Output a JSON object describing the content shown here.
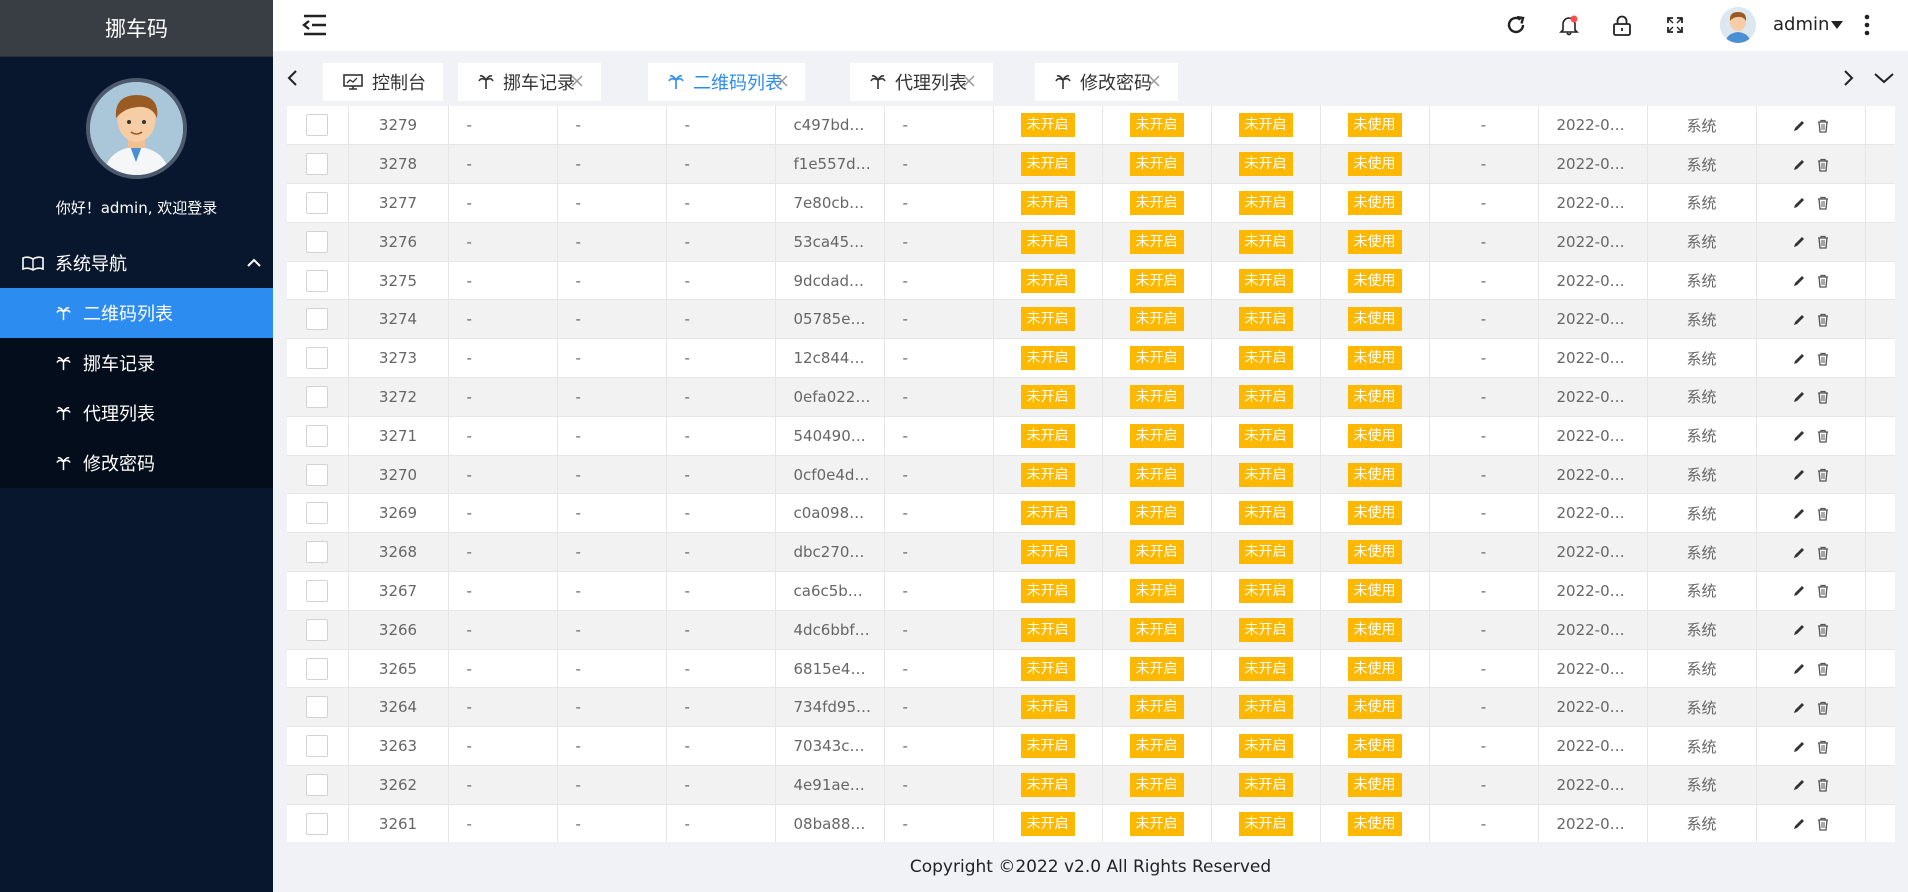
{
  "app": {
    "brand": "挪车码",
    "welcome": "你好！admin, 欢迎登录"
  },
  "sidebar": {
    "group_label": "系统导航",
    "items": [
      {
        "label": "二维码列表",
        "active": true
      },
      {
        "label": "挪车记录",
        "active": false
      },
      {
        "label": "代理列表",
        "active": false
      },
      {
        "label": "修改密码",
        "active": false
      }
    ]
  },
  "header": {
    "username": "admin"
  },
  "tabs": [
    {
      "label": "控制台",
      "icon": "monitor-icon",
      "closable": false,
      "active": false
    },
    {
      "label": "挪车记录",
      "icon": "palm-icon",
      "closable": true,
      "active": false
    },
    {
      "label": "二维码列表",
      "icon": "palm-icon",
      "closable": true,
      "active": true
    },
    {
      "label": "代理列表",
      "icon": "palm-icon",
      "closable": true,
      "active": false
    },
    {
      "label": "修改密码",
      "icon": "palm-icon",
      "closable": true,
      "active": false
    }
  ],
  "table": {
    "rows": [
      {
        "id": "3279",
        "c1": "-",
        "c2": "-",
        "c3": "-",
        "code": "c497bd…",
        "c5": "-",
        "s1": "未开启",
        "s2": "未开启",
        "s3": "未开启",
        "s4": "未使用",
        "c10": "-",
        "date": "2022-0…",
        "source": "系统"
      },
      {
        "id": "3278",
        "c1": "-",
        "c2": "-",
        "c3": "-",
        "code": "f1e557d…",
        "c5": "-",
        "s1": "未开启",
        "s2": "未开启",
        "s3": "未开启",
        "s4": "未使用",
        "c10": "-",
        "date": "2022-0…",
        "source": "系统"
      },
      {
        "id": "3277",
        "c1": "-",
        "c2": "-",
        "c3": "-",
        "code": "7e80cb…",
        "c5": "-",
        "s1": "未开启",
        "s2": "未开启",
        "s3": "未开启",
        "s4": "未使用",
        "c10": "-",
        "date": "2022-0…",
        "source": "系统"
      },
      {
        "id": "3276",
        "c1": "-",
        "c2": "-",
        "c3": "-",
        "code": "53ca45…",
        "c5": "-",
        "s1": "未开启",
        "s2": "未开启",
        "s3": "未开启",
        "s4": "未使用",
        "c10": "-",
        "date": "2022-0…",
        "source": "系统"
      },
      {
        "id": "3275",
        "c1": "-",
        "c2": "-",
        "c3": "-",
        "code": "9dcdad…",
        "c5": "-",
        "s1": "未开启",
        "s2": "未开启",
        "s3": "未开启",
        "s4": "未使用",
        "c10": "-",
        "date": "2022-0…",
        "source": "系统"
      },
      {
        "id": "3274",
        "c1": "-",
        "c2": "-",
        "c3": "-",
        "code": "05785e…",
        "c5": "-",
        "s1": "未开启",
        "s2": "未开启",
        "s3": "未开启",
        "s4": "未使用",
        "c10": "-",
        "date": "2022-0…",
        "source": "系统"
      },
      {
        "id": "3273",
        "c1": "-",
        "c2": "-",
        "c3": "-",
        "code": "12c844…",
        "c5": "-",
        "s1": "未开启",
        "s2": "未开启",
        "s3": "未开启",
        "s4": "未使用",
        "c10": "-",
        "date": "2022-0…",
        "source": "系统"
      },
      {
        "id": "3272",
        "c1": "-",
        "c2": "-",
        "c3": "-",
        "code": "0efa022…",
        "c5": "-",
        "s1": "未开启",
        "s2": "未开启",
        "s3": "未开启",
        "s4": "未使用",
        "c10": "-",
        "date": "2022-0…",
        "source": "系统"
      },
      {
        "id": "3271",
        "c1": "-",
        "c2": "-",
        "c3": "-",
        "code": "540490…",
        "c5": "-",
        "s1": "未开启",
        "s2": "未开启",
        "s3": "未开启",
        "s4": "未使用",
        "c10": "-",
        "date": "2022-0…",
        "source": "系统"
      },
      {
        "id": "3270",
        "c1": "-",
        "c2": "-",
        "c3": "-",
        "code": "0cf0e4d…",
        "c5": "-",
        "s1": "未开启",
        "s2": "未开启",
        "s3": "未开启",
        "s4": "未使用",
        "c10": "-",
        "date": "2022-0…",
        "source": "系统"
      },
      {
        "id": "3269",
        "c1": "-",
        "c2": "-",
        "c3": "-",
        "code": "c0a098…",
        "c5": "-",
        "s1": "未开启",
        "s2": "未开启",
        "s3": "未开启",
        "s4": "未使用",
        "c10": "-",
        "date": "2022-0…",
        "source": "系统"
      },
      {
        "id": "3268",
        "c1": "-",
        "c2": "-",
        "c3": "-",
        "code": "dbc270…",
        "c5": "-",
        "s1": "未开启",
        "s2": "未开启",
        "s3": "未开启",
        "s4": "未使用",
        "c10": "-",
        "date": "2022-0…",
        "source": "系统"
      },
      {
        "id": "3267",
        "c1": "-",
        "c2": "-",
        "c3": "-",
        "code": "ca6c5b…",
        "c5": "-",
        "s1": "未开启",
        "s2": "未开启",
        "s3": "未开启",
        "s4": "未使用",
        "c10": "-",
        "date": "2022-0…",
        "source": "系统"
      },
      {
        "id": "3266",
        "c1": "-",
        "c2": "-",
        "c3": "-",
        "code": "4dc6bbf…",
        "c5": "-",
        "s1": "未开启",
        "s2": "未开启",
        "s3": "未开启",
        "s4": "未使用",
        "c10": "-",
        "date": "2022-0…",
        "source": "系统"
      },
      {
        "id": "3265",
        "c1": "-",
        "c2": "-",
        "c3": "-",
        "code": "6815e4…",
        "c5": "-",
        "s1": "未开启",
        "s2": "未开启",
        "s3": "未开启",
        "s4": "未使用",
        "c10": "-",
        "date": "2022-0…",
        "source": "系统"
      },
      {
        "id": "3264",
        "c1": "-",
        "c2": "-",
        "c3": "-",
        "code": "734fd95…",
        "c5": "-",
        "s1": "未开启",
        "s2": "未开启",
        "s3": "未开启",
        "s4": "未使用",
        "c10": "-",
        "date": "2022-0…",
        "source": "系统"
      },
      {
        "id": "3263",
        "c1": "-",
        "c2": "-",
        "c3": "-",
        "code": "70343c…",
        "c5": "-",
        "s1": "未开启",
        "s2": "未开启",
        "s3": "未开启",
        "s4": "未使用",
        "c10": "-",
        "date": "2022-0…",
        "source": "系统"
      },
      {
        "id": "3262",
        "c1": "-",
        "c2": "-",
        "c3": "-",
        "code": "4e91ae…",
        "c5": "-",
        "s1": "未开启",
        "s2": "未开启",
        "s3": "未开启",
        "s4": "未使用",
        "c10": "-",
        "date": "2022-0…",
        "source": "系统"
      },
      {
        "id": "3261",
        "c1": "-",
        "c2": "-",
        "c3": "-",
        "code": "08ba88…",
        "c5": "-",
        "s1": "未开启",
        "s2": "未开启",
        "s3": "未开启",
        "s4": "未使用",
        "c10": "-",
        "date": "2022-0…",
        "source": "系统"
      }
    ]
  },
  "footer": {
    "copyright": "Copyright ©2022 v2.0 All Rights Reserved"
  },
  "colors": {
    "sidebar_bg": "#08172e",
    "accent": "#2d8cf0",
    "badge": "#ffb800"
  }
}
